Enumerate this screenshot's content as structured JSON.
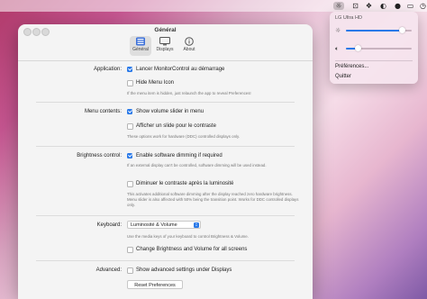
{
  "menubar": {
    "icons": [
      "brightness-icon",
      "drive-icon",
      "dropbox-icon",
      "toggle-icon",
      "record-icon",
      "battery-icon",
      "clock-icon"
    ]
  },
  "window": {
    "title": "Général",
    "tabs": [
      {
        "label": "Général",
        "icon": "general-icon",
        "selected": true
      },
      {
        "label": "Displays",
        "icon": "displays-icon",
        "selected": false
      },
      {
        "label": "About",
        "icon": "about-icon",
        "selected": false
      }
    ],
    "application": {
      "label": "Application:",
      "launch_label": "Lancer MonitorControl au démarrage",
      "launch_checked": true,
      "hide_icon_label": "Hide Menu Icon",
      "hide_icon_checked": false,
      "hint": "If the menu item is hidden, just relaunch the app to reveal Preferences!"
    },
    "menu_contents": {
      "label": "Menu contents:",
      "volume_slider_label": "Show volume slider in menu",
      "volume_slider_checked": true,
      "contrast_slider_label": "Afficher un slide pour le contraste",
      "contrast_slider_checked": false,
      "hint": "These options work for hardware (DDC) controlled displays only."
    },
    "brightness": {
      "label": "Brightness control:",
      "software_dimming_label": "Enable software dimming if required",
      "software_dimming_checked": true,
      "software_hint": "If an external display can't be controlled, software dimming will be used instead.",
      "lower_contrast_label": "Diminuer le contraste après la luminosité",
      "lower_contrast_checked": false,
      "contrast_hint": "This activates additional software dimming after the display reached zero hardware brightness. Menu slider is also affected with 50% being the transition point. Works for DDC controlled displays only."
    },
    "keyboard": {
      "label": "Keyboard:",
      "select_value": "Luminosité & Volume",
      "hint": "Use the media keys of your keyboard to control Brightness & Volume.",
      "separate_label": "Change Brightness and Volume for all screens",
      "separate_checked": false
    },
    "advanced": {
      "label": "Advanced:",
      "show_advanced_label": "Show advanced settings under Displays",
      "show_advanced_checked": false,
      "reset_label": "Reset Preferences"
    }
  },
  "popover": {
    "display_name": "LG Ultra HD",
    "brightness_level": 0.86,
    "volume_level": 0.18,
    "preferences_label": "Préférences...",
    "quit_label": "Quitter"
  },
  "colors": {
    "accent": "#2a79e8",
    "window_bg": "#f4f4f4"
  }
}
